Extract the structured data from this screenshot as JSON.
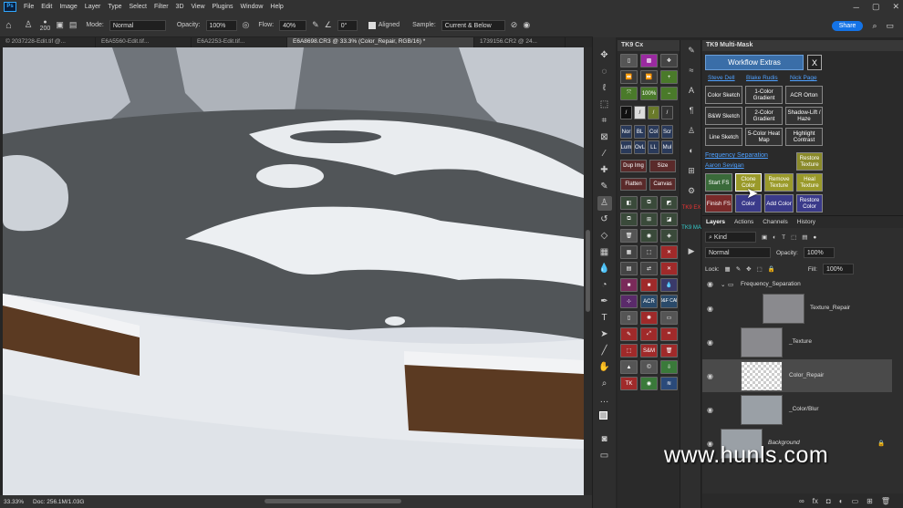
{
  "menu": {
    "items": [
      "File",
      "Edit",
      "Image",
      "Layer",
      "Type",
      "Select",
      "Filter",
      "3D",
      "View",
      "Plugins",
      "Window",
      "Help"
    ]
  },
  "options": {
    "brush_size": "200",
    "mode_label": "Mode:",
    "mode_value": "Normal",
    "opacity_label": "Opacity:",
    "opacity_value": "100%",
    "flow_label": "Flow:",
    "flow_value": "40%",
    "angle_value": "0°",
    "aligned_label": "Aligned",
    "sample_label": "Sample:",
    "sample_value": "Current & Below"
  },
  "share_label": "Share",
  "tabs": [
    {
      "label": "© 2037228-Edit.tif @..."
    },
    {
      "label": "E6A5560-Edit.tif..."
    },
    {
      "label": "E6A2253-Edit.tif..."
    },
    {
      "label": "E6A8698.CR3 @ 33.3% (Color_Repair, RGB/16) *"
    },
    {
      "label": "1739156.CR2 @ 24..."
    }
  ],
  "status": {
    "zoom": "33.33%",
    "doc": "Doc: 256.1M/1.03G"
  },
  "tk9": {
    "title": "TK9 Cx",
    "percent": "100%",
    "row_labels": [
      [
        "Nor",
        "BL",
        "Col",
        "Scr"
      ],
      [
        "Lum",
        "OvL",
        "LL",
        "Mul"
      ]
    ],
    "wide1": [
      "Dup Img",
      "Size"
    ],
    "wide2": [
      "Flatten",
      "Canvas"
    ],
    "acr": "ACR",
    "dcaf": "D&F CAF",
    "sm": "S&M",
    "tk": "TK"
  },
  "strip": {
    "tk9ex": "TK9 EX",
    "tk9ma": "TK9 MA"
  },
  "multimask": {
    "title": "TK9 Multi-Mask",
    "workflow": "Workflow Extras",
    "close": "X",
    "links": [
      "Steve Dell",
      "Blake Rudis",
      "Nick Page"
    ],
    "grid": [
      [
        "Color Sketch",
        "1-Color Gradient",
        "ACR Orton"
      ],
      [
        "B&W Sketch",
        "2-Color Gradient",
        "Shadow-Lift / Haze"
      ],
      [
        "Line Sketch",
        "5-Color Heat Map",
        "Highlight Contrast"
      ]
    ],
    "fs_title": "Frequency Separation",
    "fs_link": "Aaron Sevigan",
    "fs_restore_tex": "Restore Texture",
    "fs_start": "Start FS",
    "fs_clone": "Clone Color",
    "fs_remove": "Remove Texture",
    "fs_heal": "Heal Texture",
    "fs_finish": "Finish FS",
    "fs_color": "Color",
    "fs_add": "Add Color",
    "fs_restore_col": "Restore Color"
  },
  "layers_panel": {
    "tabs": [
      "Layers",
      "Actions",
      "Channels",
      "History"
    ],
    "kind": "Kind",
    "blend": "Normal",
    "opacity_label": "Opacity:",
    "opacity_value": "100%",
    "lock_label": "Lock:",
    "fill_label": "Fill:",
    "fill_value": "100%",
    "group": "Frequency_Separation",
    "layers": [
      "Texture_Repair",
      "_Texture",
      "Color_Repair",
      "_Color/Blur",
      "Background"
    ]
  },
  "watermark": "www.hunls.com"
}
